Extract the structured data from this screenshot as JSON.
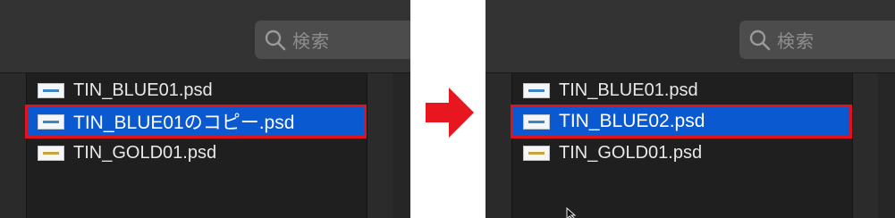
{
  "colors": {
    "selection": "#0a59d1",
    "highlight_border": "#e0121b",
    "arrow": "#e8161e"
  },
  "before": {
    "search_placeholder": "検索",
    "files": [
      {
        "name": "TIN_BLUE01.psd",
        "thumb": "blue",
        "selected": false
      },
      {
        "name": "TIN_BLUE01のコピー.psd",
        "thumb": "blue",
        "selected": true
      },
      {
        "name": "TIN_GOLD01.psd",
        "thumb": "gold",
        "selected": false
      }
    ]
  },
  "after": {
    "search_placeholder": "検索",
    "files": [
      {
        "name": "TIN_BLUE01.psd",
        "thumb": "blue",
        "selected": false
      },
      {
        "name": "TIN_BLUE02.psd",
        "thumb": "blue",
        "selected": true
      },
      {
        "name": "TIN_GOLD01.psd",
        "thumb": "gold",
        "selected": false
      }
    ]
  },
  "icons": {
    "search": "magnifier-icon",
    "arrow": "right-arrow-icon",
    "file": "psd-thumbnail-icon"
  }
}
